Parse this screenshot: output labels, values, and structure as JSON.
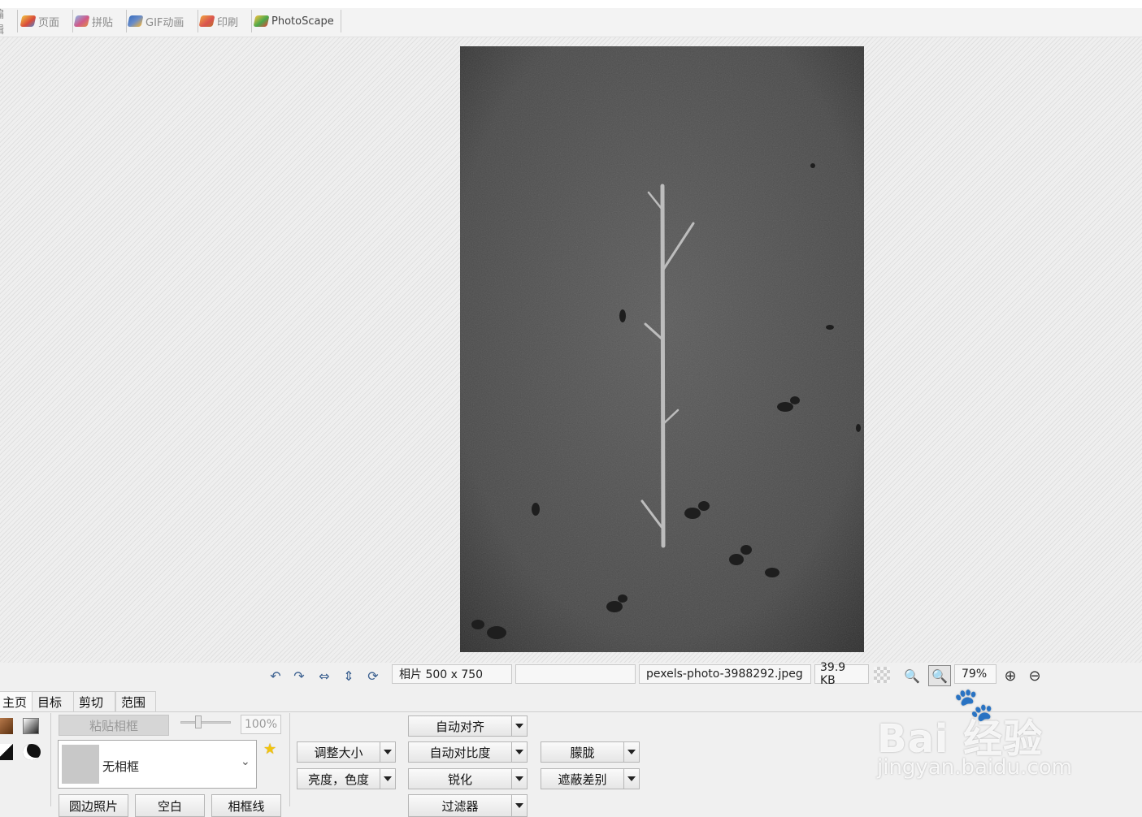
{
  "top_tabs": [
    {
      "label": "编辑"
    },
    {
      "label": "页面"
    },
    {
      "label": "拼贴"
    },
    {
      "label": "GIF动画"
    },
    {
      "label": "印刷"
    },
    {
      "label": "PhotoScape"
    }
  ],
  "status": {
    "photo_size": "相片 500 x 750",
    "blank_field": "",
    "filename": "pexels-photo-3988292.jpeg",
    "filesize": "39.9 KB",
    "zoom": "79%"
  },
  "bottom_tabs": [
    "主页",
    "目标",
    "剪切",
    "范围"
  ],
  "frame_panel": {
    "paste_frame": "粘贴相框",
    "opacity": "100%",
    "frame_select": "无相框",
    "round_photo": "圆边照片",
    "blank": "空白",
    "frame_line": "相框线"
  },
  "tools": {
    "resize": "调整大小",
    "brightness_color": "亮度，色度",
    "auto_level": "自动对齐",
    "auto_contrast": "自动对比度",
    "sharpen": "锐化",
    "filter": "过滤器",
    "blur": "朦胧",
    "mask_difference": "遮蔽差别"
  },
  "watermark": {
    "brand": "Bai 经验",
    "url": "jingyan.baidu.com"
  },
  "colors": {
    "photo_bg": "#4a4a4a",
    "tab_icon_red": "#d9534f",
    "tab_icon_blue": "#6a8cc7",
    "star": "#f1c40f"
  }
}
